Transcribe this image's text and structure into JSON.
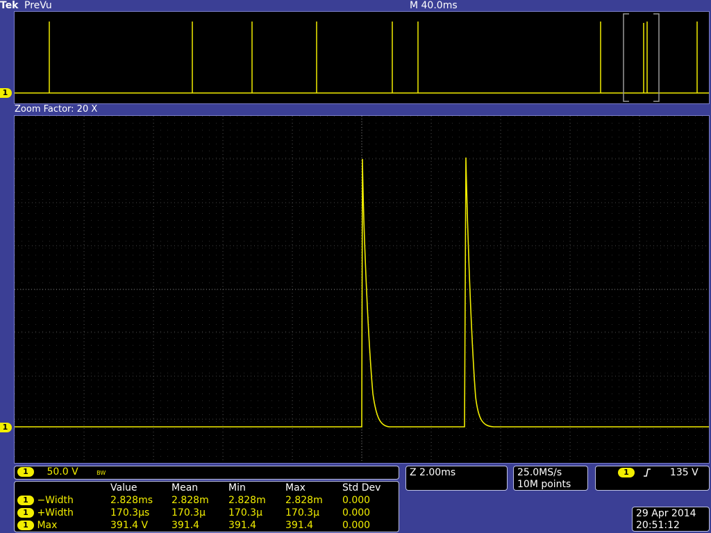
{
  "header": {
    "brand": "Tek",
    "mode": "PreVu",
    "timebase": "M 40.0ms"
  },
  "zoom": {
    "label": "Zoom Factor: 20 X"
  },
  "channel": {
    "number": "1",
    "scale": "50.0 V",
    "bw_icon": "BW",
    "color": "#f2ee00"
  },
  "zoom_scale": "Z 2.00ms",
  "acquisition": {
    "sample_rate": "25.0MS/s",
    "record_length": "10M points"
  },
  "trigger": {
    "source": "1",
    "slope_icon": "rising-edge-icon",
    "level": "135 V"
  },
  "measurements": {
    "headers": [
      "Value",
      "Mean",
      "Min",
      "Max",
      "Std Dev"
    ],
    "rows": [
      {
        "channel": "1",
        "name": "−Width",
        "value": "2.828ms",
        "mean": "2.828m",
        "min": "2.828m",
        "max": "2.828m",
        "std": "0.000"
      },
      {
        "channel": "1",
        "name": "+Width",
        "value": "170.3μs",
        "mean": "170.3μ",
        "min": "170.3μ",
        "max": "170.3μ",
        "std": "0.000"
      },
      {
        "channel": "1",
        "name": "Max",
        "value": "391.4 V",
        "mean": "391.4",
        "min": "391.4",
        "max": "391.4",
        "std": "0.000"
      }
    ]
  },
  "datetime": {
    "date": "29 Apr 2014",
    "time": "20:51:12"
  }
}
